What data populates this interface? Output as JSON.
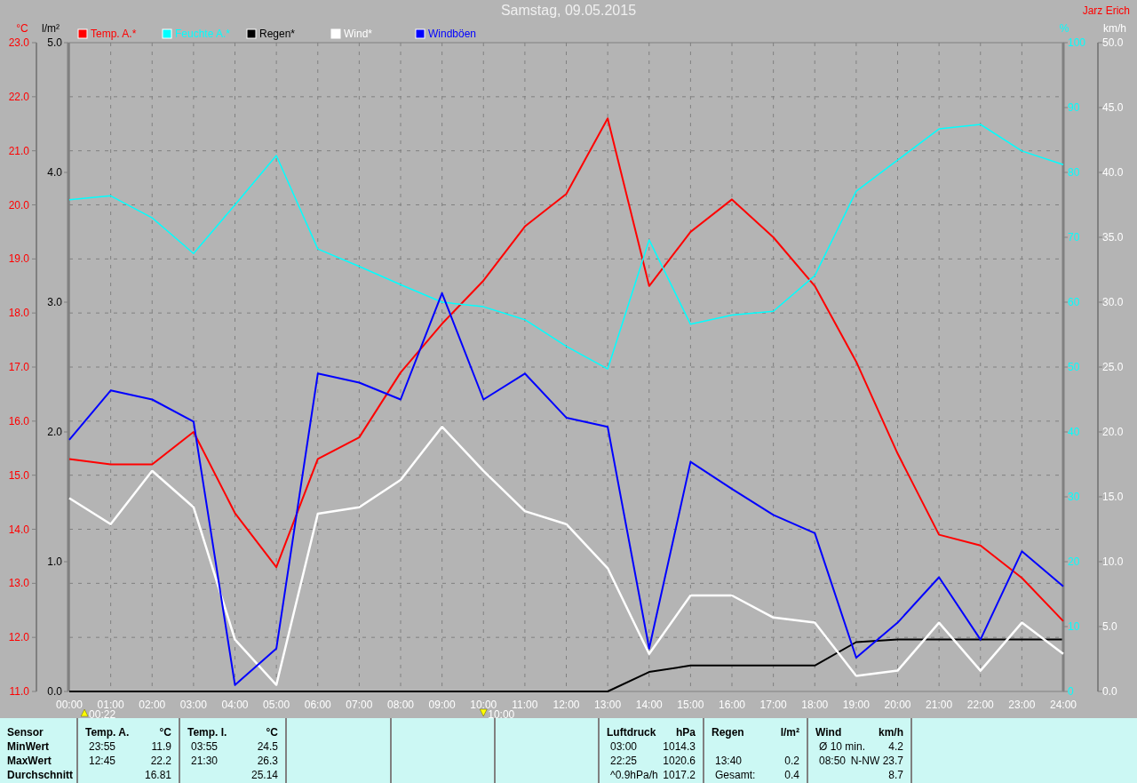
{
  "header": {
    "title": "Samstag, 09.05.2015",
    "author": "Jarz Erich"
  },
  "chart": {
    "chart_data": {
      "type": "line",
      "x": [
        "00:00",
        "01:00",
        "02:00",
        "03:00",
        "04:00",
        "05:00",
        "06:00",
        "07:00",
        "08:00",
        "09:00",
        "10:00",
        "11:00",
        "12:00",
        "13:00",
        "14:00",
        "15:00",
        "16:00",
        "17:00",
        "18:00",
        "19:00",
        "20:00",
        "21:00",
        "22:00",
        "23:00",
        "24:00"
      ],
      "ylabel": "°C",
      "ylim": [
        11,
        23
      ],
      "yticks": [
        {
          "value": 11,
          "label": "11.0"
        },
        {
          "value": 12,
          "label": "12.0"
        },
        {
          "value": 13,
          "label": "13.0"
        },
        {
          "value": 14,
          "label": "14.0"
        },
        {
          "value": 15,
          "label": "15.0"
        },
        {
          "value": 16,
          "label": "16.0"
        },
        {
          "value": 17,
          "label": "17.0"
        },
        {
          "value": 18,
          "label": "18.0"
        },
        {
          "value": 19,
          "label": "19.0"
        },
        {
          "value": 20,
          "label": "20.0"
        },
        {
          "value": 21,
          "label": "21.0"
        },
        {
          "value": 22,
          "label": "22.0"
        },
        {
          "value": 23,
          "label": "23.0"
        }
      ],
      "y2label": "%",
      "y2lim": [
        0,
        100
      ],
      "y2ticks": [
        0,
        10,
        20,
        30,
        40,
        50,
        60,
        70,
        80,
        90,
        100
      ],
      "y3label": "km/h",
      "y3lim": [
        0,
        50
      ],
      "y3ticks": [
        {
          "value": 0,
          "label": "0.0"
        },
        {
          "value": 5,
          "label": "5.0"
        },
        {
          "value": 10,
          "label": "10.0"
        },
        {
          "value": 15,
          "label": "15.0"
        },
        {
          "value": 20,
          "label": "20.0"
        },
        {
          "value": 25,
          "label": "25.0"
        },
        {
          "value": 30,
          "label": "30.0"
        },
        {
          "value": 35,
          "label": "35.0"
        },
        {
          "value": 40,
          "label": "40.0"
        },
        {
          "value": 45,
          "label": "45.0"
        },
        {
          "value": 50,
          "label": "50.0"
        }
      ],
      "series": [
        {
          "name": "Temp. A.*",
          "color": "#ff0000",
          "values": [
            15.3,
            15.2,
            15.2,
            15.8,
            14.3,
            13.3,
            15.3,
            15.7,
            16.9,
            17.8,
            18.6,
            19.6,
            20.2,
            21.6,
            18.5,
            19.5,
            20.1,
            19.4,
            18.5,
            17.1,
            15.4,
            13.9,
            13.7,
            13.1,
            12.3
          ]
        },
        {
          "name": "Feuchte A.*",
          "color": "#00ffff",
          "axis": "y2",
          "values": [
            75.8,
            76.4,
            73,
            67.5,
            75,
            82.6,
            68.2,
            65.5,
            62.7,
            60,
            59.3,
            57.3,
            53.2,
            49.7,
            69.6,
            56.6,
            58,
            58.6,
            64.1,
            77.1,
            81.9,
            86.7,
            87.4,
            83.3,
            81.2
          ]
        },
        {
          "name": "Wind*",
          "color": "#ffffff",
          "axis": "y3",
          "values": [
            14.9,
            12.9,
            17,
            14.2,
            4,
            0.5,
            13.7,
            14.2,
            16.3,
            20.4,
            17,
            13.9,
            12.9,
            9.5,
            2.9,
            7.4,
            7.4,
            5.7,
            5.3,
            1.2,
            1.6,
            5.3,
            1.6,
            5.3,
            2.9
          ]
        },
        {
          "name": "Windböen",
          "color": "#0000ff",
          "axis": "y3",
          "values": [
            19.4,
            23.2,
            22.5,
            20.8,
            0.5,
            3.3,
            24.5,
            23.8,
            22.5,
            30.7,
            22.5,
            24.5,
            21.1,
            20.4,
            3.3,
            17.7,
            15.6,
            13.6,
            12.2,
            2.6,
            5.3,
            8.8,
            4,
            10.8,
            8.1
          ]
        }
      ]
    },
    "markers": [
      {
        "label": "00:22",
        "kind": "up"
      },
      {
        "label": "10:00",
        "kind": "down"
      }
    ]
  },
  "rain_chart": {
    "chart_data": {
      "type": "line",
      "ylabel": "l/m²",
      "ylim": [
        0,
        5
      ],
      "yticks": [
        {
          "value": 0,
          "label": "0.0"
        },
        {
          "value": 1,
          "label": "1.0"
        },
        {
          "value": 2,
          "label": "2.0"
        },
        {
          "value": 3,
          "label": "3.0"
        },
        {
          "value": 4,
          "label": "4.0"
        },
        {
          "value": 5,
          "label": "5.0"
        }
      ],
      "series": [
        {
          "name": "Regen*",
          "color": "#000000",
          "values": [
            0,
            0,
            0,
            0,
            0,
            0,
            0,
            0,
            0,
            0,
            0,
            0,
            0,
            0,
            0.15,
            0.2,
            0.2,
            0.2,
            0.2,
            0.38,
            0.4,
            0.4,
            0.4,
            0.4,
            0.4
          ]
        }
      ]
    }
  },
  "stats": [
    {
      "kind": "labels",
      "title": "Sensor",
      "rows": [
        "MinWert",
        "MaxWert",
        "Durchschnitt"
      ]
    },
    {
      "kind": "values",
      "title": "Temp. A.",
      "unit": "°C",
      "rows": [
        {
          "time": "23:55",
          "value": "11.9"
        },
        {
          "time": "12:45",
          "value": "22.2"
        },
        {
          "value": "16.81"
        }
      ]
    },
    {
      "kind": "values",
      "title": "Temp. I.",
      "unit": "°C",
      "rows": [
        {
          "time": "03:55",
          "value": "24.5"
        },
        {
          "time": "21:30",
          "value": "26.3"
        },
        {
          "value": "25.14"
        }
      ]
    },
    {
      "kind": "empty"
    },
    {
      "kind": "empty"
    },
    {
      "kind": "empty"
    },
    {
      "kind": "values",
      "title": "Luftdruck",
      "unit": "hPa",
      "rows": [
        {
          "time": "03:00",
          "value": "1014.3"
        },
        {
          "time": "22:25",
          "value": "1020.6"
        },
        {
          "time": "^0.9hPa/h",
          "value": "1017.2"
        }
      ]
    },
    {
      "kind": "values",
      "title": "Regen",
      "unit": "l/m²",
      "rows": [
        {},
        {
          "time": "13:40",
          "value": "0.2"
        },
        {
          "time": "Gesamt:",
          "value": "0.4"
        }
      ]
    },
    {
      "kind": "values",
      "title": "Wind",
      "unit": "km/h",
      "rows": [
        {
          "time": "Ø 10 min.",
          "value": "4.2"
        },
        {
          "time": "08:50",
          "value": "N-NW 23.7"
        },
        {
          "value": "8.7"
        }
      ]
    }
  ]
}
